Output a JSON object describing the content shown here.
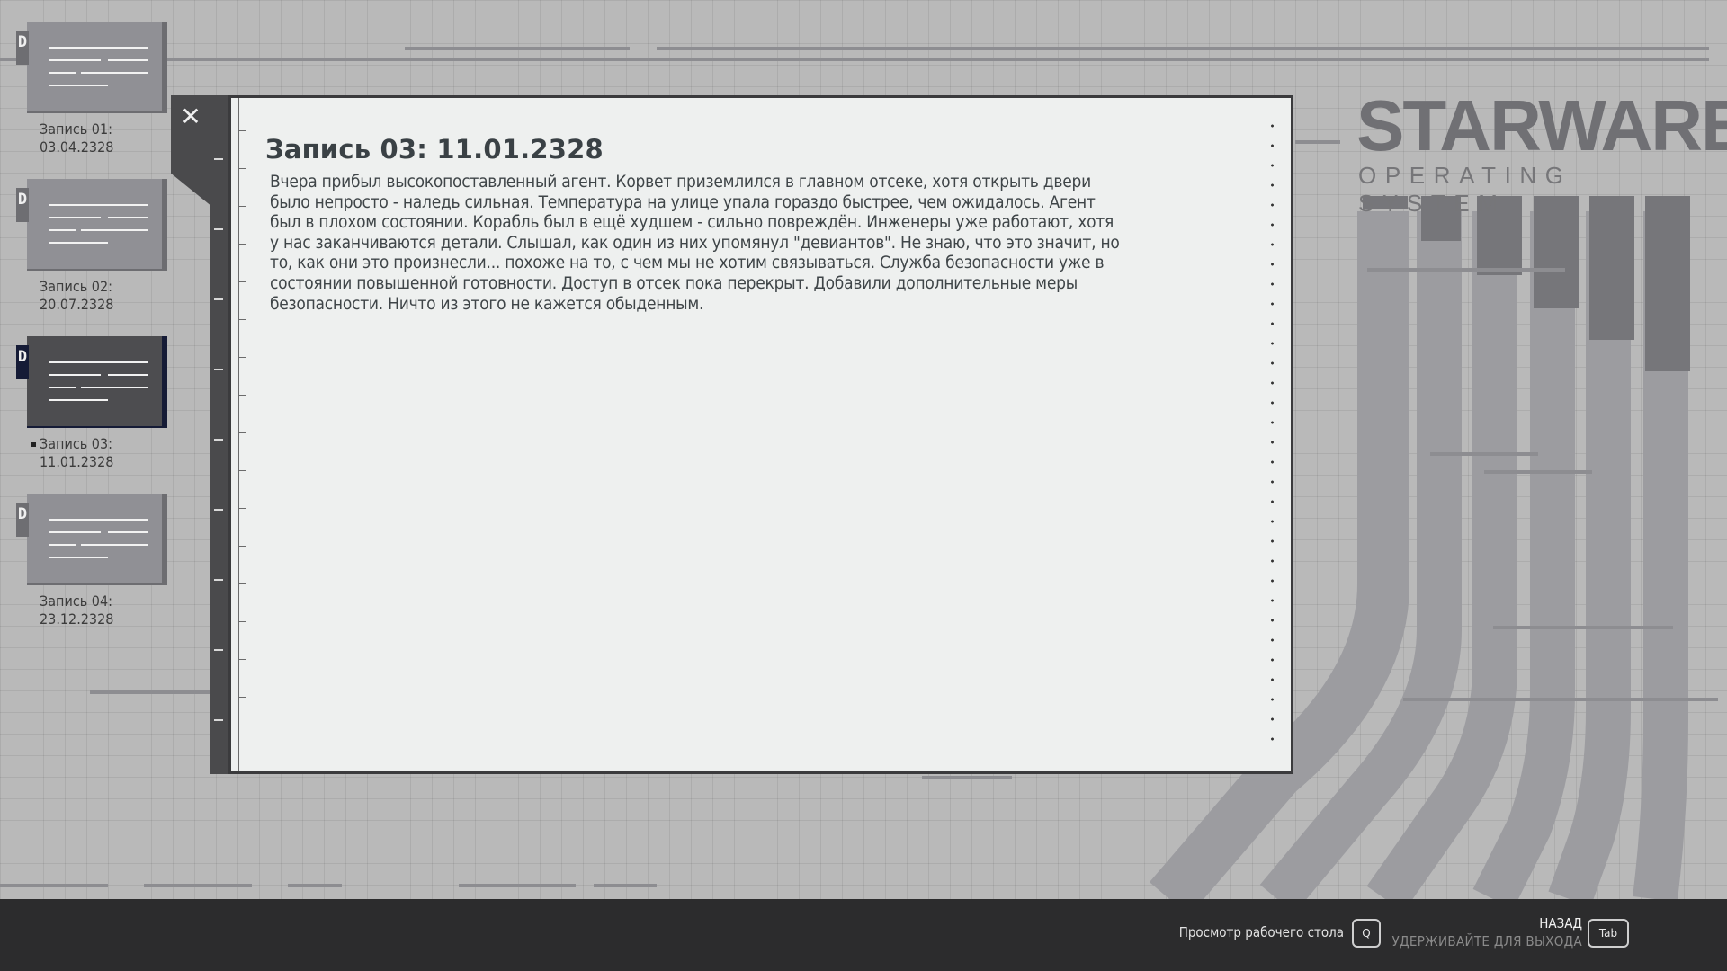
{
  "brand": {
    "name": "STARWARE",
    "subtitle": "OPERATING SYSTEM"
  },
  "sidebar": {
    "entries": [
      {
        "tab_letter": "D",
        "label": "Запись 01:\n03.04.2328",
        "active": false
      },
      {
        "tab_letter": "D",
        "label": "Запись 02:\n20.07.2328",
        "active": false
      },
      {
        "tab_letter": "D",
        "label": "Запись 03:\n11.01.2328",
        "active": true
      },
      {
        "tab_letter": "D",
        "label": "Запись 04:\n23.12.2328",
        "active": false
      }
    ]
  },
  "document": {
    "close_symbol": "✕",
    "title": "Запись 03: 11.01.2328",
    "body": "Вчера прибыл высокопоставленный агент. Корвет приземлился в главном отсеке, хотя открыть двери было непросто - наледь сильная. Температура на улице упала гораздо быстрее, чем ожидалось. Агент был в плохом состоянии. Корабль был в ещё худшем - сильно повреждён. Инженеры уже работают, хотя у нас заканчиваются детали. Слышал, как один из них упомянул \"девиантов\". Не знаю, что это значит, но то, как они это произнесли... похоже на то, с чем мы не хотим связываться. Служба безопасности уже в состоянии повышенной готовности. Доступ в отсек пока перекрыт. Добавили дополнительные меры безопасности. Ничто из этого не кажется обыденным."
  },
  "footer": {
    "desktop_view_label": "Просмотр рабочего стола",
    "desktop_view_key": "Q",
    "back_label": "НАЗАД",
    "hold_label": "УДЕРЖИВАЙТЕ ДЛЯ ВЫХОДА",
    "back_key": "Tab"
  },
  "colors": {
    "background": "#b9b9b9",
    "panel": "#eef0ef",
    "active_accent": "#151b36",
    "footer": "#2c2c2d"
  }
}
